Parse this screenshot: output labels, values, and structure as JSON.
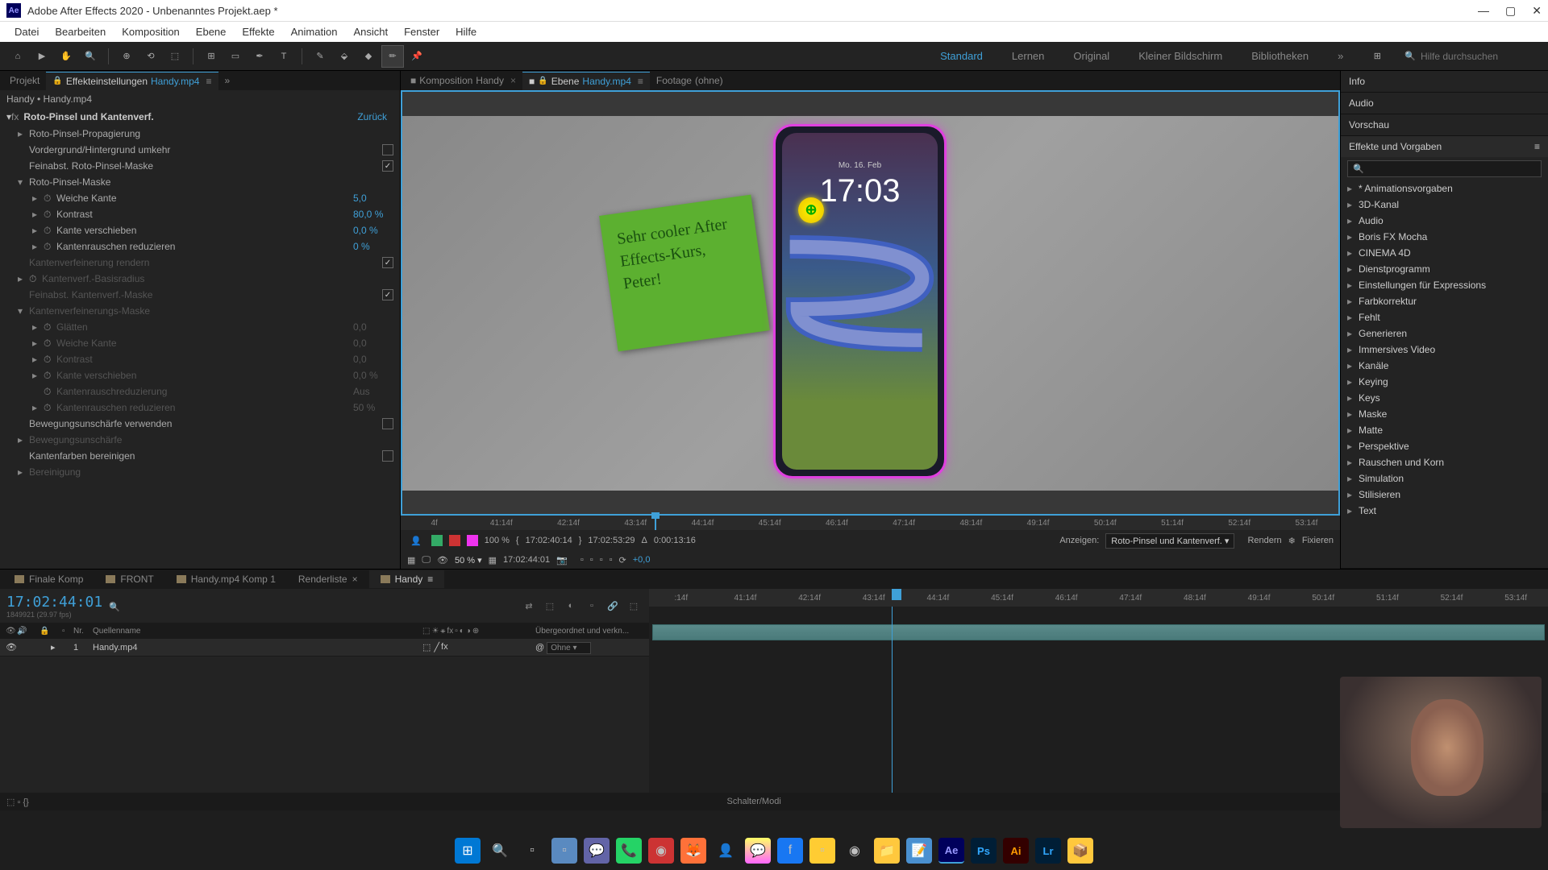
{
  "title_bar": {
    "app_name": "Adobe After Effects 2020",
    "project_name": "Unbenanntes Projekt.aep *"
  },
  "menu": {
    "datei": "Datei",
    "bearbeiten": "Bearbeiten",
    "komposition": "Komposition",
    "ebene": "Ebene",
    "effekte": "Effekte",
    "animation": "Animation",
    "ansicht": "Ansicht",
    "fenster": "Fenster",
    "hilfe": "Hilfe"
  },
  "workspaces": {
    "standard": "Standard",
    "lernen": "Lernen",
    "original": "Original",
    "kleiner": "Kleiner Bildschirm",
    "bibliotheken": "Bibliotheken"
  },
  "search": {
    "placeholder": "Hilfe durchsuchen"
  },
  "left_panel": {
    "tab_projekt": "Projekt",
    "tab_effekteinstellungen": "Effekteinstellungen",
    "tab_layer_name": "Handy.mp4",
    "breadcrumb": "Handy • Handy.mp4",
    "effect_name": "Roto-Pinsel und Kantenverf.",
    "reset": "Zurück",
    "props": {
      "propagierung": "Roto-Pinsel-Propagierung",
      "vordergrund": "Vordergrund/Hintergrund umkehr",
      "feinabst": "Feinabst. Roto-Pinsel-Maske",
      "maske": "Roto-Pinsel-Maske",
      "weiche_kante": "Weiche Kante",
      "weiche_kante_val": "5,0",
      "kontrast": "Kontrast",
      "kontrast_val": "80,0 %",
      "kante_verschieben": "Kante verschieben",
      "kante_verschieben_val": "0,0 %",
      "kantenrauschen": "Kantenrauschen reduzieren",
      "kantenrauschen_val": "0 %",
      "kantenverf_rendern": "Kantenverfeinerung rendern",
      "kantenverf_basisradius": "Kantenverf.-Basisradius",
      "feinabst_kantenverf": "Feinabst. Kantenverf.-Maske",
      "kantenverf_maske": "Kantenverfeinerungs-Maske",
      "glaetten": "Glätten",
      "glaetten_val": "0,0",
      "weiche_kante2": "Weiche Kante",
      "weiche_kante2_val": "0,0",
      "kontrast2": "Kontrast",
      "kontrast2_val": "0,0",
      "kante_verschieben2": "Kante verschieben",
      "kante_verschieben2_val": "0,0 %",
      "kantenrauschreduzierung": "Kantenrauschreduzierung",
      "kantenrauschreduzierung_val": "Aus",
      "kantenrauschen2": "Kantenrauschen reduzieren",
      "kantenrauschen2_val": "50 %",
      "bewegungsunschaerfe": "Bewegungsunschärfe verwenden",
      "bewegungsunschaerfe2": "Bewegungsunschärfe",
      "kantenfarben": "Kantenfarben bereinigen",
      "bereinigung": "Bereinigung"
    }
  },
  "center_panel": {
    "tab_komposition": "Komposition",
    "tab_komposition_name": "Handy",
    "tab_ebene": "Ebene",
    "tab_ebene_name": "Handy.mp4",
    "tab_footage": "Footage",
    "tab_footage_sub": "(ohne)",
    "sticky_note": "Sehr cooler After Effects-Kurs, Peter!",
    "phone_time": "17:03",
    "phone_date": "Mo. 16. Feb",
    "timeline_ticks": [
      "4f",
      "41:14f",
      "42:14f",
      "43:14f",
      "44:14f",
      "45:14f",
      "46:14f",
      "47:14f",
      "48:14f",
      "49:14f",
      "50:14f",
      "51:14f",
      "52:14f",
      "53:14f"
    ],
    "controls": {
      "ratio": "100 %",
      "tc_in": "17:02:40:14",
      "tc_out": "17:02:53:29",
      "duration": "0:00:13:16",
      "anzeigen_label": "Anzeigen:",
      "anzeigen_value": "Roto-Pinsel und Kantenverf.",
      "rendern": "Rendern",
      "fixieren": "Fixieren"
    },
    "footer": {
      "zoom": "50 %",
      "timecode": "17:02:44:01",
      "offset": "+0,0"
    }
  },
  "right_panel": {
    "info": "Info",
    "audio": "Audio",
    "vorschau": "Vorschau",
    "effekte_vorgaben": "Effekte und Vorgaben",
    "categories": [
      "* Animationsvorgaben",
      "3D-Kanal",
      "Audio",
      "Boris FX Mocha",
      "CINEMA 4D",
      "Dienstprogramm",
      "Einstellungen für Expressions",
      "Farbkorrektur",
      "Fehlt",
      "Generieren",
      "Immersives Video",
      "Kanäle",
      "Keying",
      "Keys",
      "Maske",
      "Matte",
      "Perspektive",
      "Rauschen und Korn",
      "Simulation",
      "Stilisieren",
      "Text"
    ]
  },
  "timeline": {
    "tabs": {
      "finale_komp": "Finale Komp",
      "front": "FRONT",
      "handy_komp": "Handy.mp4 Komp 1",
      "renderliste": "Renderliste",
      "handy": "Handy"
    },
    "timecode": "17:02:44:01",
    "timecode_sub": "1849921 (29.97 fps)",
    "ruler_ticks": [
      ":14f",
      "41:14f",
      "42:14f",
      "43:14f",
      "44:14f",
      "45:14f",
      "46:14f",
      "47:14f",
      "48:14f",
      "49:14f",
      "50:14f",
      "51:14f",
      "52:14f",
      "53:14f"
    ],
    "columns": {
      "nr": "Nr.",
      "quellenname": "Quellenname",
      "übergeordnet": "Übergeordnet und verkn..."
    },
    "layer": {
      "num": "1",
      "name": "Handy.mp4",
      "parent": "Ohne"
    },
    "footer": "Schalter/Modi"
  }
}
